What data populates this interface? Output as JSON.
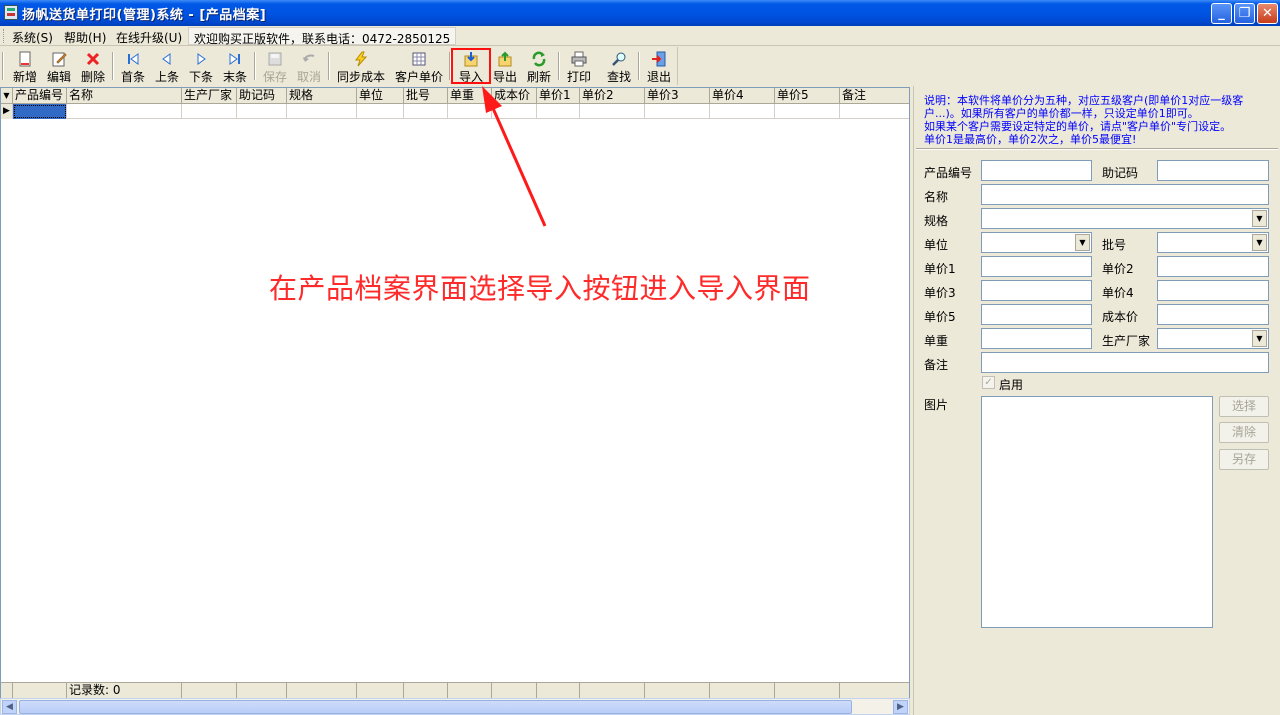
{
  "window": {
    "title": "扬帆送货单打印(管理)系统 - [产品档案]"
  },
  "menu": {
    "items": [
      {
        "label": "系统(S)"
      },
      {
        "label": "帮助(H)"
      },
      {
        "label": "在线升级(U)"
      },
      {
        "label": "欢迎购买正版软件，联系电话：0472-2850125"
      }
    ]
  },
  "toolbar": {
    "buttons": [
      {
        "label": "新增",
        "icon": "new-doc-icon"
      },
      {
        "label": "编辑",
        "icon": "edit-icon"
      },
      {
        "label": "删除",
        "icon": "delete-x-icon"
      },
      {
        "label": "首条",
        "icon": "first-record-icon"
      },
      {
        "label": "上条",
        "icon": "prev-record-icon"
      },
      {
        "label": "下条",
        "icon": "next-record-icon"
      },
      {
        "label": "末条",
        "icon": "last-record-icon"
      },
      {
        "label": "保存",
        "icon": "save-icon",
        "disabled": true
      },
      {
        "label": "取消",
        "icon": "cancel-icon",
        "disabled": true
      },
      {
        "label": "同步成本",
        "icon": "lightning-icon"
      },
      {
        "label": "客户单价",
        "icon": "price-table-icon"
      },
      {
        "label": "导入",
        "icon": "import-icon",
        "highlighted": true
      },
      {
        "label": "导出",
        "icon": "export-icon"
      },
      {
        "label": "刷新",
        "icon": "refresh-icon"
      },
      {
        "label": "打印",
        "icon": "printer-icon"
      },
      {
        "label": "查找",
        "icon": "search-icon"
      },
      {
        "label": "退出",
        "icon": "exit-icon"
      }
    ]
  },
  "grid": {
    "columns": [
      "产品编号",
      "名称",
      "生产厂家",
      "助记码",
      "规格",
      "单位",
      "批号",
      "单重",
      "成本价",
      "单价1",
      "单价2",
      "单价3",
      "单价4",
      "单价5",
      "备注"
    ],
    "footer": "记录数: 0"
  },
  "annotation": "在产品档案界面选择导入按钮进入导入界面",
  "form": {
    "note_lines": [
      "说明：本软件将单价分为五种，对应五级客户(即单价1对应一级客户...)。如果所有客户的单价都一样，只设定单价1即可。",
      "如果某个客户需要设定特定的单价，请点\"客户单价\"专门设定。",
      "单价1是最高价，单价2次之，单价5最便宜!"
    ],
    "labels": {
      "product_code": "产品编号",
      "mnemonic": "助记码",
      "name": "名称",
      "spec": "规格",
      "unit": "单位",
      "batch": "批号",
      "price1": "单价1",
      "price2": "单价2",
      "price3": "单价3",
      "price4": "单价4",
      "price5": "单价5",
      "cost": "成本价",
      "weight": "单重",
      "manufacturer": "生产厂家",
      "remark": "备注",
      "enabled": "启用",
      "picture": "图片"
    },
    "buttons": {
      "select": "选择",
      "clear": "清除",
      "save_as": "另存"
    }
  },
  "colors": {
    "highlight": "#ff1010",
    "annotation": "#ff2a2a",
    "note": "#0000ff",
    "titlebar": "#0054E3"
  }
}
